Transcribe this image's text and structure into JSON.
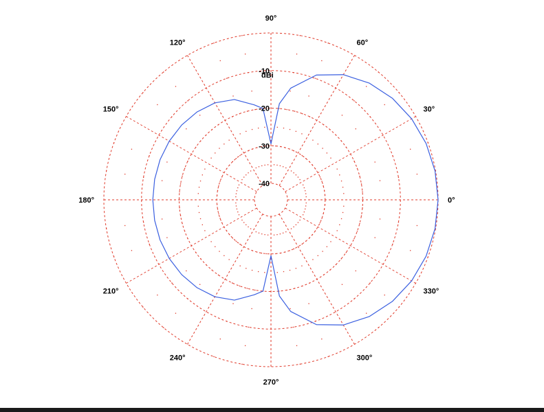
{
  "chart_data": {
    "type": "polar",
    "unit_label": "dBi",
    "radial_min": -40,
    "radial_max": 0,
    "radial_rings": [
      -40,
      -30,
      -20,
      -10,
      0
    ],
    "radial_tick_labels": [
      "-10",
      "-20",
      "-30",
      "-40"
    ],
    "angle_ticks_deg": [
      0,
      30,
      60,
      90,
      120,
      150,
      180,
      210,
      240,
      270,
      300,
      330
    ],
    "angle_tick_labels": [
      "0°",
      "30°",
      "60°",
      "90°",
      "120°",
      "150°",
      "180°",
      "210°",
      "240°",
      "270°",
      "300°",
      "330°"
    ],
    "grid": true,
    "series": [
      {
        "angles_deg": [
          0,
          10,
          20,
          30,
          40,
          50,
          60,
          70,
          80,
          85,
          90,
          95,
          100,
          110,
          120,
          130,
          140,
          150,
          160,
          170,
          180,
          190,
          200,
          210,
          220,
          230,
          240,
          250,
          260,
          265,
          270,
          275,
          280,
          290,
          300,
          310,
          320,
          330,
          340,
          350,
          360
        ],
        "values": [
          0,
          -0.14,
          -0.54,
          -1.25,
          -2.32,
          -3.83,
          -5.94,
          -9.06,
          -14.23,
          -18.72,
          -29.5,
          -20.0,
          -18.73,
          -15.99,
          -14.61,
          -13.86,
          -13.43,
          -13.18,
          -13.05,
          -13.01,
          -13.0,
          -13.01,
          -13.05,
          -13.18,
          -13.43,
          -13.86,
          -14.61,
          -15.99,
          -18.73,
          -20.0,
          -29.5,
          -18.72,
          -14.23,
          -9.06,
          -5.94,
          -3.83,
          -2.32,
          -1.25,
          -0.54,
          -0.14,
          0
        ],
        "color": "#3a5fe0"
      }
    ],
    "grid_color": "#e03a2a"
  }
}
